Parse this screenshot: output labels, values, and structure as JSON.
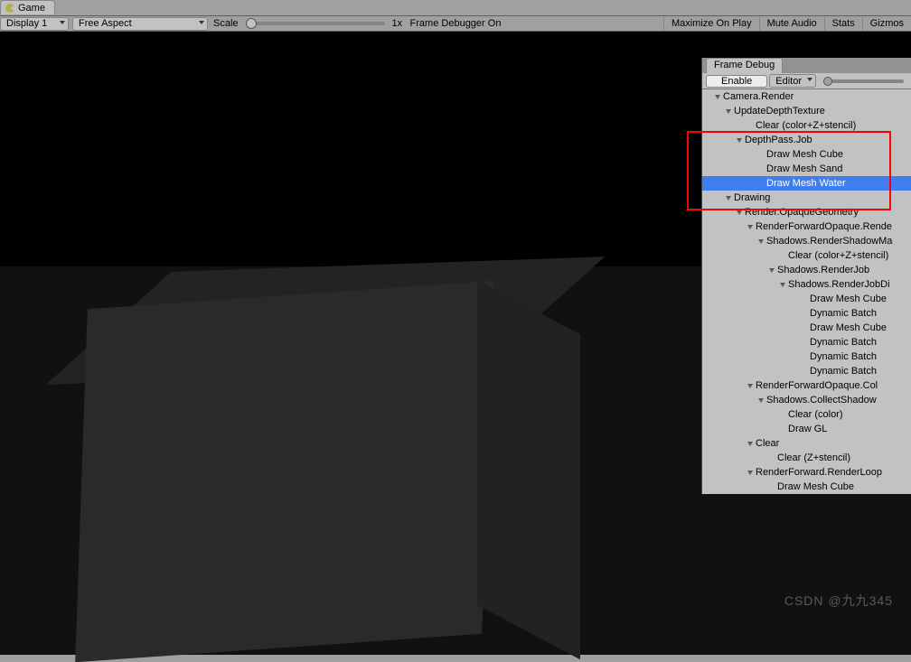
{
  "tab": {
    "title": "Game"
  },
  "toolbar": {
    "display": "Display 1",
    "aspect": "Free Aspect",
    "scale_label": "Scale",
    "scale_value": "1x",
    "status": "Frame Debugger On",
    "maximize": "Maximize On Play",
    "mute": "Mute Audio",
    "stats": "Stats",
    "gizmos": "Gizmos"
  },
  "panel": {
    "title": "Frame Debug",
    "enable": "Enable",
    "editor": "Editor"
  },
  "tree": [
    {
      "ind": 14,
      "arrow": true,
      "label": "Camera.Render"
    },
    {
      "ind": 26,
      "arrow": true,
      "label": "UpdateDepthTexture"
    },
    {
      "ind": 50,
      "arrow": false,
      "label": "Clear (color+Z+stencil)"
    },
    {
      "ind": 38,
      "arrow": true,
      "label": "DepthPass.Job"
    },
    {
      "ind": 62,
      "arrow": false,
      "label": "Draw Mesh Cube"
    },
    {
      "ind": 62,
      "arrow": false,
      "label": "Draw Mesh Sand"
    },
    {
      "ind": 62,
      "arrow": false,
      "label": "Draw Mesh Water",
      "sel": true
    },
    {
      "ind": 26,
      "arrow": true,
      "label": "Drawing"
    },
    {
      "ind": 38,
      "arrow": true,
      "label": "Render.OpaqueGeometry"
    },
    {
      "ind": 50,
      "arrow": true,
      "label": "RenderForwardOpaque.Rende"
    },
    {
      "ind": 62,
      "arrow": true,
      "label": "Shadows.RenderShadowMa"
    },
    {
      "ind": 86,
      "arrow": false,
      "label": "Clear (color+Z+stencil)"
    },
    {
      "ind": 74,
      "arrow": true,
      "label": "Shadows.RenderJob"
    },
    {
      "ind": 86,
      "arrow": true,
      "label": "Shadows.RenderJobDi"
    },
    {
      "ind": 110,
      "arrow": false,
      "label": "Draw Mesh Cube"
    },
    {
      "ind": 110,
      "arrow": false,
      "label": "Dynamic Batch"
    },
    {
      "ind": 110,
      "arrow": false,
      "label": "Draw Mesh Cube"
    },
    {
      "ind": 110,
      "arrow": false,
      "label": "Dynamic Batch"
    },
    {
      "ind": 110,
      "arrow": false,
      "label": "Dynamic Batch"
    },
    {
      "ind": 110,
      "arrow": false,
      "label": "Dynamic Batch"
    },
    {
      "ind": 50,
      "arrow": true,
      "label": "RenderForwardOpaque.Col"
    },
    {
      "ind": 62,
      "arrow": true,
      "label": "Shadows.CollectShadow"
    },
    {
      "ind": 86,
      "arrow": false,
      "label": "Clear (color)"
    },
    {
      "ind": 86,
      "arrow": false,
      "label": "Draw GL"
    },
    {
      "ind": 50,
      "arrow": true,
      "label": "Clear"
    },
    {
      "ind": 74,
      "arrow": false,
      "label": "Clear (Z+stencil)"
    },
    {
      "ind": 50,
      "arrow": true,
      "label": "RenderForward.RenderLoop"
    },
    {
      "ind": 74,
      "arrow": false,
      "label": "Draw Mesh Cube"
    }
  ],
  "watermark": "CSDN @九九345"
}
